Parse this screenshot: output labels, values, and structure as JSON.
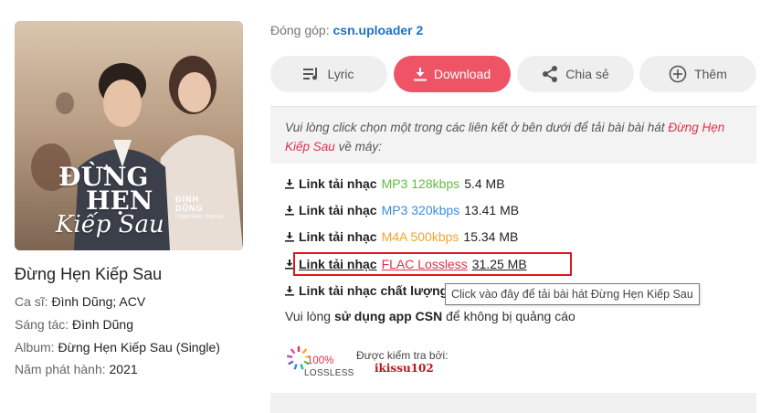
{
  "cover": {
    "title_line1": "ĐỪNG",
    "title_line2": "HẸN",
    "title_line3": "Kiếp Sau",
    "artist_line1": "ĐÌNH",
    "artist_line2": "DŨNG",
    "artist_credit": "COMPOSER | SINGER"
  },
  "song": {
    "title": "Đừng Hẹn Kiếp Sau",
    "singer_label": "Ca sĩ:",
    "singer_value": "Đình Dũng; ACV",
    "composer_label": "Sáng tác:",
    "composer_value": "Đình Dũng",
    "album_label": "Album:",
    "album_value": "Đừng Hẹn Kiếp Sau (Single)",
    "year_label": "Năm phát hành:",
    "year_value": "2021"
  },
  "contributor": {
    "label": "Đóng góp:",
    "name": "csn.uploader 2"
  },
  "actions": {
    "lyric": "Lyric",
    "download": "Download",
    "share": "Chia sẻ",
    "more": "Thêm"
  },
  "notice": {
    "text_before": "Vui lòng click chọn một trong các liên kết ở bên dưới để tải bài bài hát",
    "song": "Đừng Hẹn Kiếp Sau",
    "text_after": "về máy:"
  },
  "downloads": [
    {
      "label": "Link tải nhạc",
      "format": "MP3 128kbps",
      "size": "5.4 MB",
      "color": "#5fbf3f"
    },
    {
      "label": "Link tải nhạc",
      "format": "MP3 320kbps",
      "size": "13.41 MB",
      "color": "#3b8de0"
    },
    {
      "label": "Link tải nhạc",
      "format": "M4A 500kbps",
      "size": "15.34 MB",
      "color": "#f2a531"
    },
    {
      "label": "Link tải nhạc",
      "format": "FLAC Lossless",
      "size": "31.25 MB",
      "color": "#e0314b"
    },
    {
      "label": "Link tải nhạc chất lượng"
    }
  ],
  "tooltip": "Click vào đây để tải bài hát Đừng Hẹn Kiếp Sau",
  "app_note": {
    "before": "Vui lòng",
    "bold": "sử dụng app CSN",
    "after": "để không bị quảng cáo"
  },
  "badge": {
    "percent": "100%",
    "label": "LOSSLESS"
  },
  "checked_by": {
    "label": "Được kiểm tra bởi:",
    "name": "ikissu102"
  }
}
